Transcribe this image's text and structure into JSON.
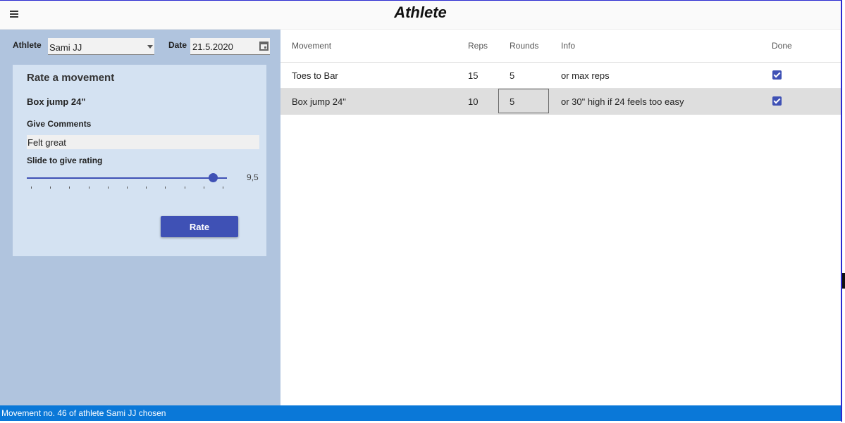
{
  "header": {
    "title": "Athlete"
  },
  "filters": {
    "athlete_label": "Athlete",
    "athlete_value": "Sami JJ",
    "date_label": "Date",
    "date_value": "21.5.2020"
  },
  "rating_card": {
    "title": "Rate a movement",
    "movement": "Box jump 24\"",
    "comments_label": "Give Comments",
    "comment_value": "Felt great",
    "slider_label": "Slide to give rating",
    "rating_value": "9,5",
    "rating_min": 0,
    "rating_max": 10,
    "rate_button": "Rate"
  },
  "table": {
    "columns": [
      "Movement",
      "Reps",
      "Rounds",
      "Info",
      "Done"
    ],
    "rows": [
      {
        "movement": "Toes to Bar",
        "reps": "15",
        "rounds": "5",
        "info": "or max reps",
        "done": true,
        "selected": false
      },
      {
        "movement": "Box jump 24\"",
        "reps": "10",
        "rounds": "5",
        "info": "or 30\" high if 24 feels too easy",
        "done": true,
        "selected": true
      }
    ]
  },
  "status_bar": {
    "text": "Movement no. 46 of athlete Sami JJ chosen"
  },
  "colors": {
    "accent": "#3f51b5",
    "left_panel": "#b0c4de",
    "card": "#d4e2f2",
    "status": "#0a78d8"
  },
  "icons": {
    "menu": "hamburger-icon",
    "calendar": "calendar-icon",
    "dropdown": "chevron-down-icon",
    "check": "checkbox-checked-icon"
  }
}
